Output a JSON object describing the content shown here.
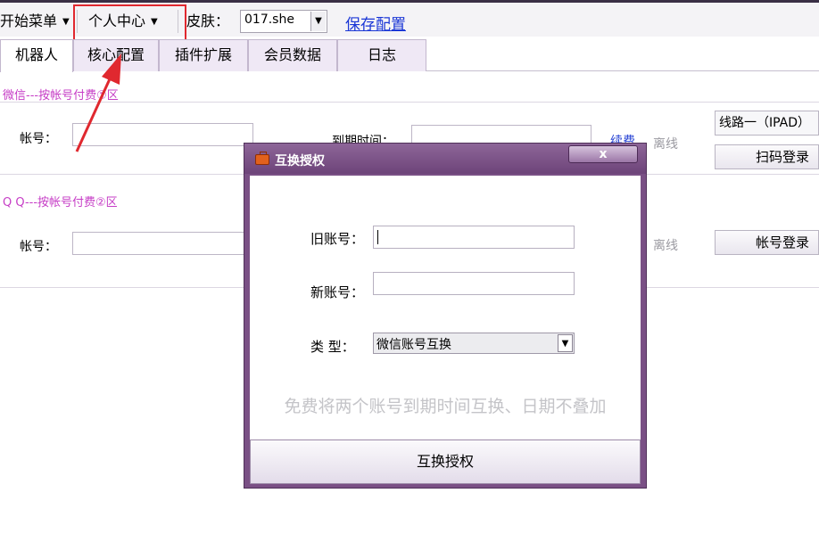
{
  "menubar": {
    "start_menu": "开始菜单",
    "personal_center": "个人中心",
    "skin_label": "皮肤：",
    "skin_value": "017.she",
    "save_config": "保存配置"
  },
  "tabs": [
    {
      "label": "机器人",
      "active": true
    },
    {
      "label": "核心配置",
      "active": false
    },
    {
      "label": "插件扩展",
      "active": false
    },
    {
      "label": "会员数据",
      "active": false
    },
    {
      "label": "日志",
      "active": false
    }
  ],
  "wechat_section": {
    "title": "微信---按帐号付费①区",
    "account_label": "帐号：",
    "expire_label": "到期时间：",
    "renew_link": "续费",
    "status": "离线",
    "route": "线路一（IPAD）",
    "login_button": "扫码登录"
  },
  "qq_section": {
    "title": "Q Q---按帐号付费②区",
    "account_label": "帐号：",
    "status": "离线",
    "login_button": "帐号登录"
  },
  "dialog": {
    "title": "互换授权",
    "close": "x",
    "old_account_label": "旧账号：",
    "new_account_label": "新账号：",
    "type_label": "类  型：",
    "type_value": "微信账号互换",
    "hint": "免费将两个账号到期时间互换、日期不叠加",
    "submit": "互换授权"
  },
  "colors": {
    "section_title": "#c63dc6",
    "link": "#1a36d6",
    "dialog_frame": "#7a5085",
    "highlight": "#e0282f"
  }
}
